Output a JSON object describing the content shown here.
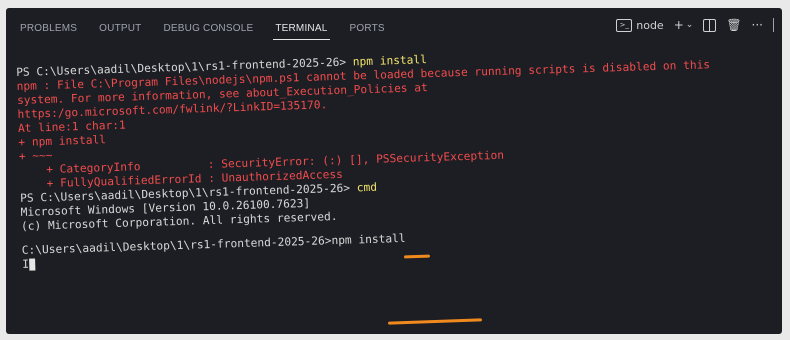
{
  "panel": {
    "tabs": [
      {
        "label": "PROBLEMS",
        "active": false
      },
      {
        "label": "OUTPUT",
        "active": false
      },
      {
        "label": "DEBUG CONSOLE",
        "active": false
      },
      {
        "label": "TERMINAL",
        "active": true
      },
      {
        "label": "PORTS",
        "active": false
      }
    ],
    "actions": {
      "terminal_icon": "terminal-icon",
      "shell_label": "node",
      "new_terminal_icon": "plus-icon",
      "dropdown_icon": "chevron-down-icon",
      "split_icon": "split-terminal-icon",
      "trash_icon": "trash-icon",
      "more_icon": "ellipsis-icon"
    }
  },
  "terminal": {
    "prompt1": "PS C:\\Users\\aadil\\Desktop\\1\\rs1-frontend-2025-26> ",
    "command1": "npm install",
    "error_lines": [
      "npm : File C:\\Program Files\\nodejs\\npm.ps1 cannot be loaded because running scripts is disabled on this",
      "system. For more information, see about_Execution_Policies at",
      "https:/go.microsoft.com/fwlink/?LinkID=135170.",
      "At line:1 char:1",
      "+ npm install",
      "+ ~~~",
      "    + CategoryInfo          : SecurityError: (:) [], PSSecurityException",
      "    + FullyQualifiedErrorId : UnauthorizedAccess"
    ],
    "prompt2": "PS C:\\Users\\aadil\\Desktop\\1\\rs1-frontend-2025-26> ",
    "command2": "cmd",
    "cmd_banner": [
      "Microsoft Windows [Version 10.0.26100.7623]",
      "(c) Microsoft Corporation. All rights reserved."
    ],
    "prompt3": "C:\\Users\\aadil\\Desktop\\1\\rs1-frontend-2025-26>",
    "command3": "npm install",
    "cursor_prefix": "I"
  },
  "colors": {
    "background": "#1c1e24",
    "error": "#f14c4c",
    "command_highlight": "#f2e36a",
    "annotation": "#f08a1c"
  }
}
